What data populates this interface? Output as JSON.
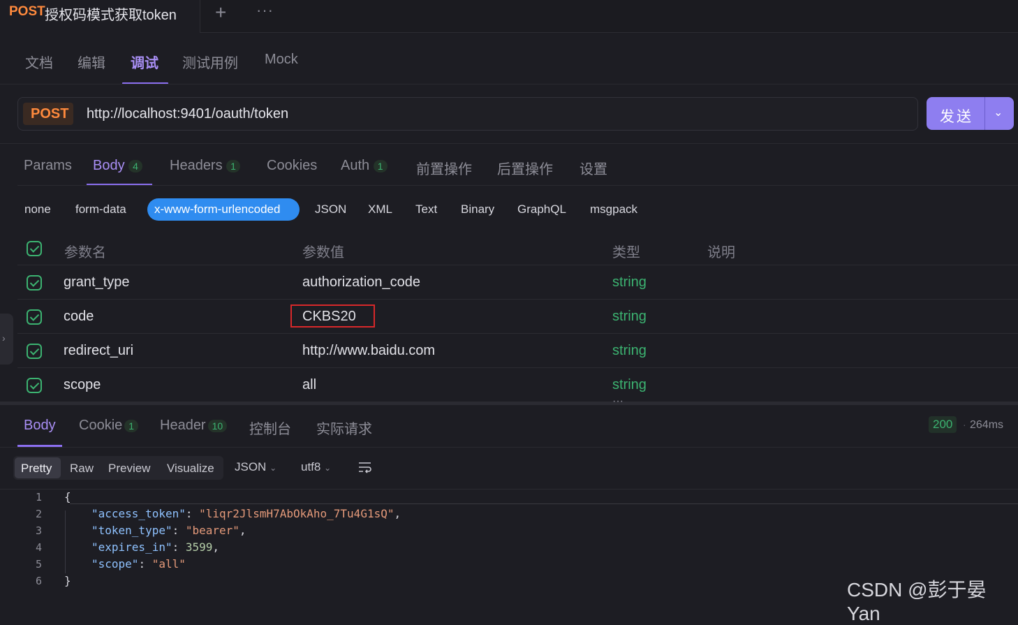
{
  "tab": {
    "method": "POST",
    "title": "授权码模式获取token",
    "plus": "+",
    "more": "···"
  },
  "mode_tabs": [
    "文档",
    "编辑",
    "调试",
    "测试用例",
    "Mock"
  ],
  "url_bar": {
    "method": "POST",
    "url": "http://localhost:9401/oauth/token",
    "send": "发送",
    "send_chevron": "⌄"
  },
  "request_tabs": [
    {
      "label": "Params"
    },
    {
      "label": "Body",
      "badge": "4"
    },
    {
      "label": "Headers",
      "badge": "1"
    },
    {
      "label": "Cookies"
    },
    {
      "label": "Auth",
      "badge": "1"
    },
    {
      "label": "前置操作"
    },
    {
      "label": "后置操作"
    },
    {
      "label": "设置"
    }
  ],
  "body_types": [
    "none",
    "form-data",
    "x-www-form-urlencoded",
    "JSON",
    "XML",
    "Text",
    "Binary",
    "GraphQL",
    "msgpack"
  ],
  "params_table": {
    "headers": [
      "参数名",
      "参数值",
      "类型",
      "说明"
    ],
    "rows": [
      {
        "name": "grant_type",
        "value": "authorization_code",
        "type": "string"
      },
      {
        "name": "code",
        "value": "CKBS20",
        "type": "string"
      },
      {
        "name": "redirect_uri",
        "value": "http://www.baidu.com",
        "type": "string"
      },
      {
        "name": "scope",
        "value": "all",
        "type": "string"
      }
    ]
  },
  "side_handle": "›",
  "split_dots": "···",
  "response_tabs": [
    {
      "label": "Body"
    },
    {
      "label": "Cookie",
      "badge": "1"
    },
    {
      "label": "Header",
      "badge": "10"
    },
    {
      "label": "控制台"
    },
    {
      "label": "实际请求"
    }
  ],
  "status": {
    "code": "200",
    "dot": "·",
    "time": "264ms"
  },
  "view_options": [
    "Pretty",
    "Raw",
    "Preview",
    "Visualize"
  ],
  "format": {
    "type": "JSON",
    "encoding": "utf8"
  },
  "code": {
    "line_numbers": [
      "1",
      "2",
      "3",
      "4",
      "5",
      "6"
    ],
    "open": "{",
    "close": "}",
    "entries": [
      {
        "key": "\"access_token\"",
        "value": "\"liqr2JlsmH7AbOkAho_7Tu4G1sQ\"",
        "sep": ",",
        "kind": "string"
      },
      {
        "key": "\"token_type\"",
        "value": "\"bearer\"",
        "sep": ",",
        "kind": "string"
      },
      {
        "key": "\"expires_in\"",
        "value": "3599",
        "sep": ",",
        "kind": "number"
      },
      {
        "key": "\"scope\"",
        "value": "\"all\"",
        "sep": "",
        "kind": "string"
      }
    ]
  },
  "watermark": "CSDN @彭于晏Yan",
  "colors": {
    "accent": "#8b6ff0",
    "method": "#ff8a3d",
    "string_type": "#3cb371",
    "highlight": "#d8282a",
    "pill": "#2f8cf0"
  }
}
